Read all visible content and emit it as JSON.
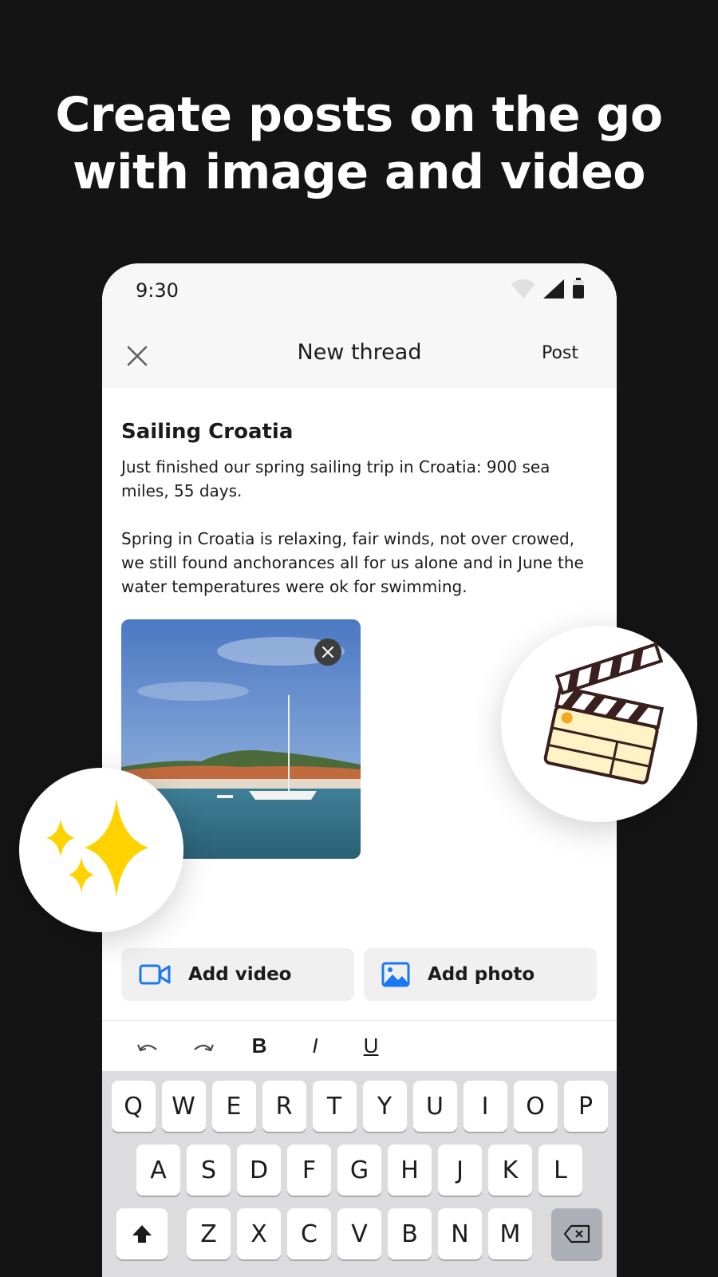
{
  "headline": {
    "line1": "Create posts on the go",
    "line2": "with image and video"
  },
  "statusbar": {
    "time": "9:30",
    "icons": [
      "wifi-icon",
      "signal-icon",
      "battery-icon"
    ]
  },
  "topbar": {
    "close_icon": "close-icon",
    "title": "New thread",
    "post_label": "Post"
  },
  "post": {
    "title": "Sailing Croatia",
    "paragraph1": "Just finished our spring sailing trip in Croatia: 900 sea miles, 55 days.",
    "paragraph2": "Spring in Croatia is relaxing, fair winds, not over crowed, we still found anchorances all for us alone and in June the water temperatures were ok for swimming."
  },
  "actions": {
    "add_video": "Add video",
    "add_photo": "Add photo",
    "accent": "#1877f2"
  },
  "formatting": [
    "undo-icon",
    "redo-icon",
    "bold-icon",
    "italic-icon",
    "underline-icon"
  ],
  "keyboard": {
    "row1": [
      "Q",
      "W",
      "E",
      "R",
      "T",
      "Y",
      "U",
      "I",
      "O",
      "P"
    ],
    "row2": [
      "A",
      "S",
      "D",
      "F",
      "G",
      "H",
      "J",
      "K",
      "L"
    ],
    "row3": [
      "Z",
      "X",
      "C",
      "V",
      "B",
      "N",
      "M"
    ]
  },
  "decorations": {
    "sparkles_color": "#ffd200",
    "clapper": "clapperboard-icon"
  }
}
